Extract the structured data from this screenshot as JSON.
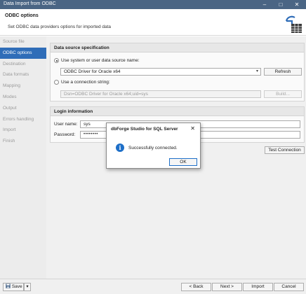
{
  "window": {
    "title": "Data Import from ODBC"
  },
  "header": {
    "title": "ODBC options",
    "subtitle": "Set ODBC data providers options for imported data",
    "icon": "import-table-icon"
  },
  "sidebar": {
    "items": [
      {
        "label": "Source file",
        "active": false
      },
      {
        "label": "ODBC options",
        "active": true
      },
      {
        "label": "Destination",
        "active": false
      },
      {
        "label": "Data formats",
        "active": false
      },
      {
        "label": "Mapping",
        "active": false
      },
      {
        "label": "Modes",
        "active": false
      },
      {
        "label": "Output",
        "active": false
      },
      {
        "label": "Errors handling",
        "active": false
      },
      {
        "label": "Import",
        "active": false
      },
      {
        "label": "Finish",
        "active": false
      }
    ]
  },
  "datasource": {
    "title": "Data source specification",
    "option_dsn_label": "Use system or user data source name:",
    "dsn_value": "ODBC Driver for Oracle x64",
    "refresh_label": "Refresh",
    "option_conn_label": "Use a connection string:",
    "conn_value": "Dsn=ODBC Driver for Oracle x64;uid=sys",
    "build_label": "Build..."
  },
  "login": {
    "title": "Login information",
    "username_label": "User name:",
    "username_value": "sys",
    "password_label": "Password:",
    "password_value": "••••••••"
  },
  "test_connection_label": "Test Connection",
  "dialog": {
    "title": "dbForge Studio for SQL Server",
    "close": "✕",
    "message": "Successfully connected.",
    "ok_label": "OK"
  },
  "footer": {
    "save_label": "Save",
    "back_label": "< Back",
    "next_label": "Next >",
    "import_label": "Import",
    "cancel_label": "Cancel"
  },
  "colors": {
    "accent": "#2f6db8",
    "titlebar": "#4a6584"
  }
}
